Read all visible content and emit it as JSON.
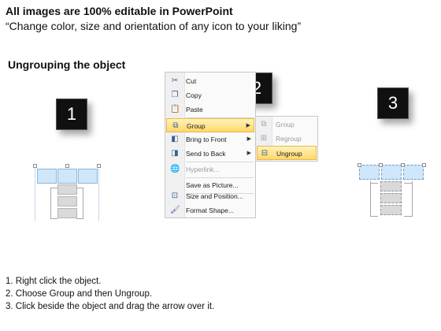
{
  "header": {
    "title": "All images are 100% editable in PowerPoint",
    "subtitle": "“Change color, size and orientation of any icon to your liking”"
  },
  "section_title": "Ungrouping the object",
  "steps": [
    "1",
    "2",
    "3"
  ],
  "context_menu": {
    "items": [
      {
        "label": "Cut",
        "icon": "scissors-icon"
      },
      {
        "label": "Copy",
        "icon": "copy-icon"
      },
      {
        "label": "Paste",
        "icon": "paste-icon"
      },
      {
        "label": "Group",
        "icon": "group-icon",
        "submenu": true,
        "highlighted": true
      },
      {
        "label": "Bring to Front",
        "icon": "bring-front-icon",
        "submenu": true
      },
      {
        "label": "Send to Back",
        "icon": "send-back-icon",
        "submenu": true
      },
      {
        "label": "Hyperlink...",
        "icon": "hyperlink-icon",
        "disabled": true
      },
      {
        "label": "Save as Picture...",
        "icon": "save-picture-icon"
      },
      {
        "label": "Size and Position...",
        "icon": "size-position-icon"
      },
      {
        "label": "Format Shape...",
        "icon": "format-shape-icon"
      }
    ]
  },
  "submenu": {
    "items": [
      {
        "label": "Group",
        "icon": "group-icon",
        "disabled": true
      },
      {
        "label": "Regroup",
        "icon": "regroup-icon",
        "disabled": true
      },
      {
        "label": "Ungroup",
        "icon": "ungroup-icon",
        "highlighted": true
      }
    ]
  },
  "instructions": [
    "1.   Right click the object.",
    "2.   Choose Group and then Ungroup.",
    "3.   Click beside the object and drag the arrow over it."
  ],
  "colors": {
    "highlight": "#ffd86a",
    "blue_box": "#cfe6fb",
    "gray_box": "#d9d9d9"
  }
}
